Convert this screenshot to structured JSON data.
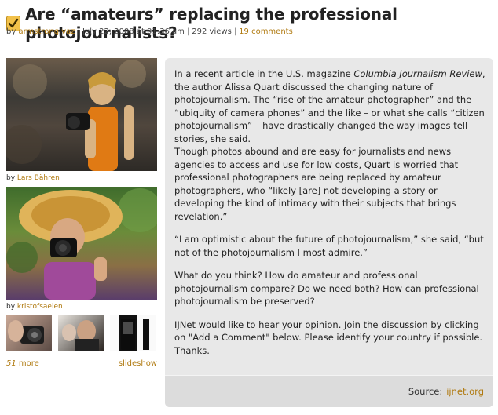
{
  "post": {
    "title": "Are “amateurs” replacing the professional photojournalists?",
    "author": "armstrong vaz",
    "date": "July 22, 2008 at 01:36 am",
    "views": "292 views",
    "comments": "19 comments"
  },
  "photos": [
    {
      "by_label": "by",
      "credit": "Lars Bähren"
    },
    {
      "by_label": "by",
      "credit": "kristofsaelen"
    }
  ],
  "gallery": {
    "more_count": "51",
    "more_label": "more",
    "slideshow_label": "slideshow"
  },
  "article": {
    "p1_intro": "In a recent article in the U.S. magazine ",
    "p1_magazine": "Columbia Journalism Review",
    "p1_rest": ", the author Alissa Quart discussed the changing nature of photojournalism. The “rise of the amateur photographer” and the “ubiquity of camera phones” and the like – or what she calls “citizen photojournalism” – have drastically changed the way images tell stories, she said.",
    "p2": "Though photos abound and are easy for journalists and news agencies to access and use for low costs, Quart is worried that professional photographers are being replaced by amateur photographers, who “likely [are] not developing a story or developing the kind of intimacy with their subjects that brings revelation.”",
    "p3": "“I am optimistic about the future of photojournalism,” she said, “but not of the photojournalism I most admire.”",
    "p4": "What do you think? How do amateur and professional photojournalism compare? Do we need both? How can professional photojournalism be preserved?",
    "p5": "IJNet would like to hear your opinion. Join the discussion by clicking on \"Add a Comment\" below. Please identify your country if possible. Thanks.",
    "source_label": "Source:",
    "source_link": "ijnet.org"
  },
  "colors": {
    "link": "#b07a10",
    "panel": "#e8e8e8",
    "check": "#f2c14a"
  },
  "icons": {
    "title_icon": "checkmark-icon"
  }
}
